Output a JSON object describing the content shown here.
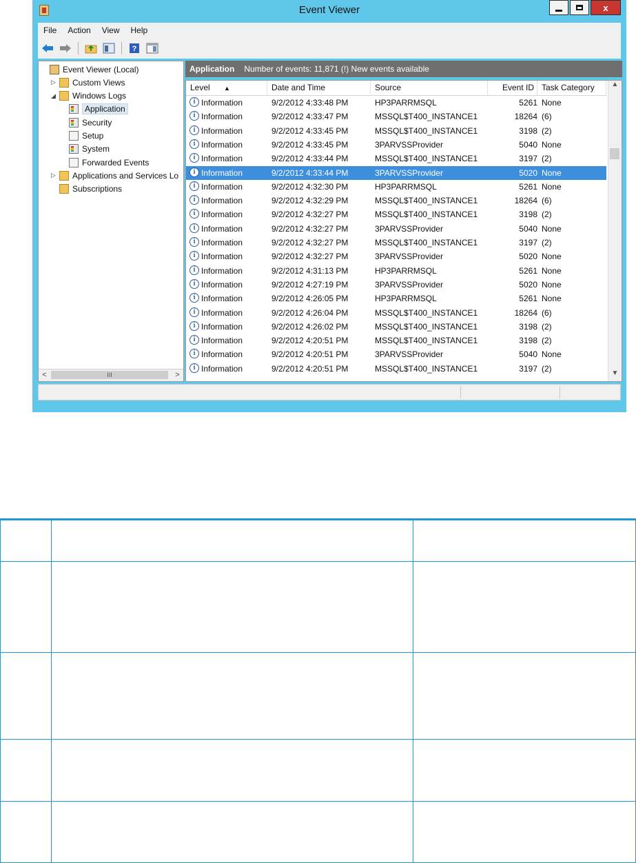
{
  "window": {
    "title": "Event Viewer",
    "close_glyph": "x"
  },
  "menu": [
    "File",
    "Action",
    "View",
    "Help"
  ],
  "toolbar_icons": [
    "back-arrow-icon",
    "forward-arrow-icon",
    "up-folder-icon",
    "show-hide-tree-icon",
    "help-icon",
    "action-pane-icon"
  ],
  "tree": [
    {
      "label": "Event Viewer (Local)",
      "icon": "root",
      "level": 0,
      "arrow": ""
    },
    {
      "label": "Custom Views",
      "icon": "folder",
      "level": 1,
      "arrow": "▷"
    },
    {
      "label": "Windows Logs",
      "icon": "folder",
      "level": 1,
      "arrow": "◢"
    },
    {
      "label": "Application",
      "icon": "log",
      "level": 2,
      "arrow": "",
      "selected": true
    },
    {
      "label": "Security",
      "icon": "log",
      "level": 2,
      "arrow": ""
    },
    {
      "label": "Setup",
      "icon": "plain",
      "level": 2,
      "arrow": ""
    },
    {
      "label": "System",
      "icon": "log",
      "level": 2,
      "arrow": ""
    },
    {
      "label": "Forwarded Events",
      "icon": "plain",
      "level": 2,
      "arrow": ""
    },
    {
      "label": "Applications and Services Lo",
      "icon": "folder",
      "level": 1,
      "arrow": "▷"
    },
    {
      "label": "Subscriptions",
      "icon": "folder",
      "level": 1,
      "arrow": ""
    }
  ],
  "hscroll": {
    "left": "<",
    "right": ">",
    "thumb": "III"
  },
  "pane_header": {
    "title": "Application",
    "info": "Number of events: 11,871 (!) New events available"
  },
  "columns": [
    "Level",
    "Date and Time",
    "Source",
    "Event ID",
    "Task Category"
  ],
  "events": [
    {
      "level": "Information",
      "datetime": "9/2/2012 4:33:48 PM",
      "source": "HP3PARRMSQL",
      "event_id": "5261",
      "category": "None"
    },
    {
      "level": "Information",
      "datetime": "9/2/2012 4:33:47 PM",
      "source": "MSSQL$T400_INSTANCE1",
      "event_id": "18264",
      "category": "(6)"
    },
    {
      "level": "Information",
      "datetime": "9/2/2012 4:33:45 PM",
      "source": "MSSQL$T400_INSTANCE1",
      "event_id": "3198",
      "category": "(2)"
    },
    {
      "level": "Information",
      "datetime": "9/2/2012 4:33:45 PM",
      "source": "3PARVSSProvider",
      "event_id": "5040",
      "category": "None"
    },
    {
      "level": "Information",
      "datetime": "9/2/2012 4:33:44 PM",
      "source": "MSSQL$T400_INSTANCE1",
      "event_id": "3197",
      "category": "(2)"
    },
    {
      "level": "Information",
      "datetime": "9/2/2012 4:33:44 PM",
      "source": "3PARVSSProvider",
      "event_id": "5020",
      "category": "None",
      "selected": true
    },
    {
      "level": "Information",
      "datetime": "9/2/2012 4:32:30 PM",
      "source": "HP3PARRMSQL",
      "event_id": "5261",
      "category": "None"
    },
    {
      "level": "Information",
      "datetime": "9/2/2012 4:32:29 PM",
      "source": "MSSQL$T400_INSTANCE1",
      "event_id": "18264",
      "category": "(6)"
    },
    {
      "level": "Information",
      "datetime": "9/2/2012 4:32:27 PM",
      "source": "MSSQL$T400_INSTANCE1",
      "event_id": "3198",
      "category": "(2)"
    },
    {
      "level": "Information",
      "datetime": "9/2/2012 4:32:27 PM",
      "source": "3PARVSSProvider",
      "event_id": "5040",
      "category": "None"
    },
    {
      "level": "Information",
      "datetime": "9/2/2012 4:32:27 PM",
      "source": "MSSQL$T400_INSTANCE1",
      "event_id": "3197",
      "category": "(2)"
    },
    {
      "level": "Information",
      "datetime": "9/2/2012 4:32:27 PM",
      "source": "3PARVSSProvider",
      "event_id": "5020",
      "category": "None"
    },
    {
      "level": "Information",
      "datetime": "9/2/2012 4:31:13 PM",
      "source": "HP3PARRMSQL",
      "event_id": "5261",
      "category": "None"
    },
    {
      "level": "Information",
      "datetime": "9/2/2012 4:27:19 PM",
      "source": "3PARVSSProvider",
      "event_id": "5020",
      "category": "None"
    },
    {
      "level": "Information",
      "datetime": "9/2/2012 4:26:05 PM",
      "source": "HP3PARRMSQL",
      "event_id": "5261",
      "category": "None"
    },
    {
      "level": "Information",
      "datetime": "9/2/2012 4:26:04 PM",
      "source": "MSSQL$T400_INSTANCE1",
      "event_id": "18264",
      "category": "(6)"
    },
    {
      "level": "Information",
      "datetime": "9/2/2012 4:26:02 PM",
      "source": "MSSQL$T400_INSTANCE1",
      "event_id": "3198",
      "category": "(2)"
    },
    {
      "level": "Information",
      "datetime": "9/2/2012 4:20:51 PM",
      "source": "MSSQL$T400_INSTANCE1",
      "event_id": "3198",
      "category": "(2)"
    },
    {
      "level": "Information",
      "datetime": "9/2/2012 4:20:51 PM",
      "source": "3PARVSSProvider",
      "event_id": "5040",
      "category": "None"
    },
    {
      "level": "Information",
      "datetime": "9/2/2012 4:20:51 PM",
      "source": "MSSQL$T400_INSTANCE1",
      "event_id": "3197",
      "category": "(2)"
    }
  ],
  "colors": {
    "window_frame": "#5fc8ea",
    "selection": "#3e8ede",
    "pane_header": "#6f6f6f",
    "table_rule": "#1f96d6"
  }
}
